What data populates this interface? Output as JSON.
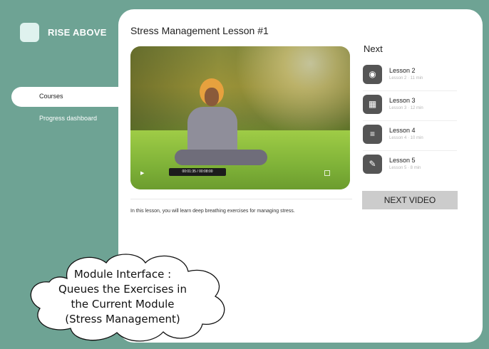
{
  "brand": {
    "name": "RISE ABOVE"
  },
  "nav": {
    "active": "Courses",
    "items": [
      "Courses",
      "Progress dashboard"
    ]
  },
  "lesson": {
    "title": "Stress Management Lesson #1",
    "video_time": "00:01:35 / 00:08:00",
    "description": "In this lesson, you will learn deep breathing exercises for managing stress."
  },
  "next": {
    "heading": "Next",
    "items": [
      {
        "name": "Lesson 2",
        "meta": "Lesson 2 · 11 min",
        "icon": "toggle-icon"
      },
      {
        "name": "Lesson 3",
        "meta": "Lesson 3 · 12 min",
        "icon": "grid-icon"
      },
      {
        "name": "Lesson 4",
        "meta": "Lesson 4 · 10 min",
        "icon": "list-icon"
      },
      {
        "name": "Lesson 5",
        "meta": "Lesson 5 · 8 min",
        "icon": "pencil-icon"
      }
    ],
    "button_label": "NEXT VIDEO"
  },
  "annotation": {
    "lines": [
      "Module Interface :",
      "Queues the Exercises in",
      "the Current Module",
      "(Stress Management)"
    ]
  },
  "colors": {
    "background": "#6ea394",
    "panel": "#ffffff",
    "button": "#cccccc",
    "lesson_icon": "#555555"
  }
}
